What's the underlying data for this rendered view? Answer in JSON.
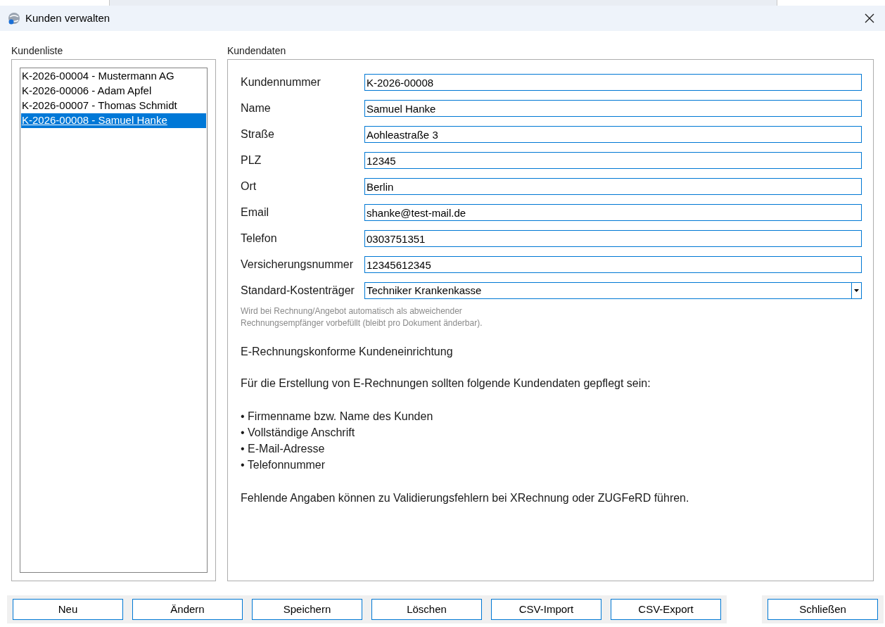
{
  "window": {
    "title": "Kunden verwalten"
  },
  "customer_list": {
    "title": "Kundenliste",
    "items": [
      {
        "label": "K-2026-00004 - Mustermann AG",
        "selected": false
      },
      {
        "label": "K-2026-00006 - Adam Apfel",
        "selected": false
      },
      {
        "label": "K-2026-00007 - Thomas Schmidt",
        "selected": false
      },
      {
        "label": "K-2026-00008 - Samuel Hanke",
        "selected": true
      }
    ]
  },
  "customer_data": {
    "title": "Kundendaten",
    "fields": [
      {
        "label": "Kundennummer",
        "value": "K-2026-00008",
        "kind": "text"
      },
      {
        "label": "Name",
        "value": "Samuel Hanke",
        "kind": "text"
      },
      {
        "label": "Straße",
        "value": "Aohleastraße 3",
        "kind": "text"
      },
      {
        "label": "PLZ",
        "value": "12345",
        "kind": "text"
      },
      {
        "label": "Ort",
        "value": "Berlin",
        "kind": "text"
      },
      {
        "label": "Email",
        "value": "shanke@test-mail.de",
        "kind": "text"
      },
      {
        "label": "Telefon",
        "value": "0303751351",
        "kind": "text"
      },
      {
        "label": "Versicherungsnummer",
        "value": "12345612345",
        "kind": "text"
      },
      {
        "label": "Standard-Kostenträger",
        "value": "Techniker Krankenkasse",
        "kind": "select"
      }
    ],
    "hint": [
      "Wird bei Rechnung/Angebot automatisch als abweichender",
      "Rechnungsempfänger vorbefüllt (bleibt pro Dokument änderbar)."
    ],
    "info_title": "E-Rechnungskonforme Kundeneinrichtung",
    "info_intro": "Für die Erstellung von E-Rechnungen sollten folgende Kundendaten gepflegt sein:",
    "info_bullets": [
      "• Firmenname bzw. Name des Kunden",
      "• Vollständige Anschrift",
      "• E-Mail-Adresse",
      "• Telefonnummer"
    ],
    "info_note": "Fehlende Angaben können zu Validierungsfehlern bei XRechnung oder ZUGFeRD führen."
  },
  "buttons": [
    "Neu",
    "Ändern",
    "Speichern",
    "Löschen",
    "CSV-Import",
    "CSV-Export"
  ],
  "close_button": "Schließen"
}
